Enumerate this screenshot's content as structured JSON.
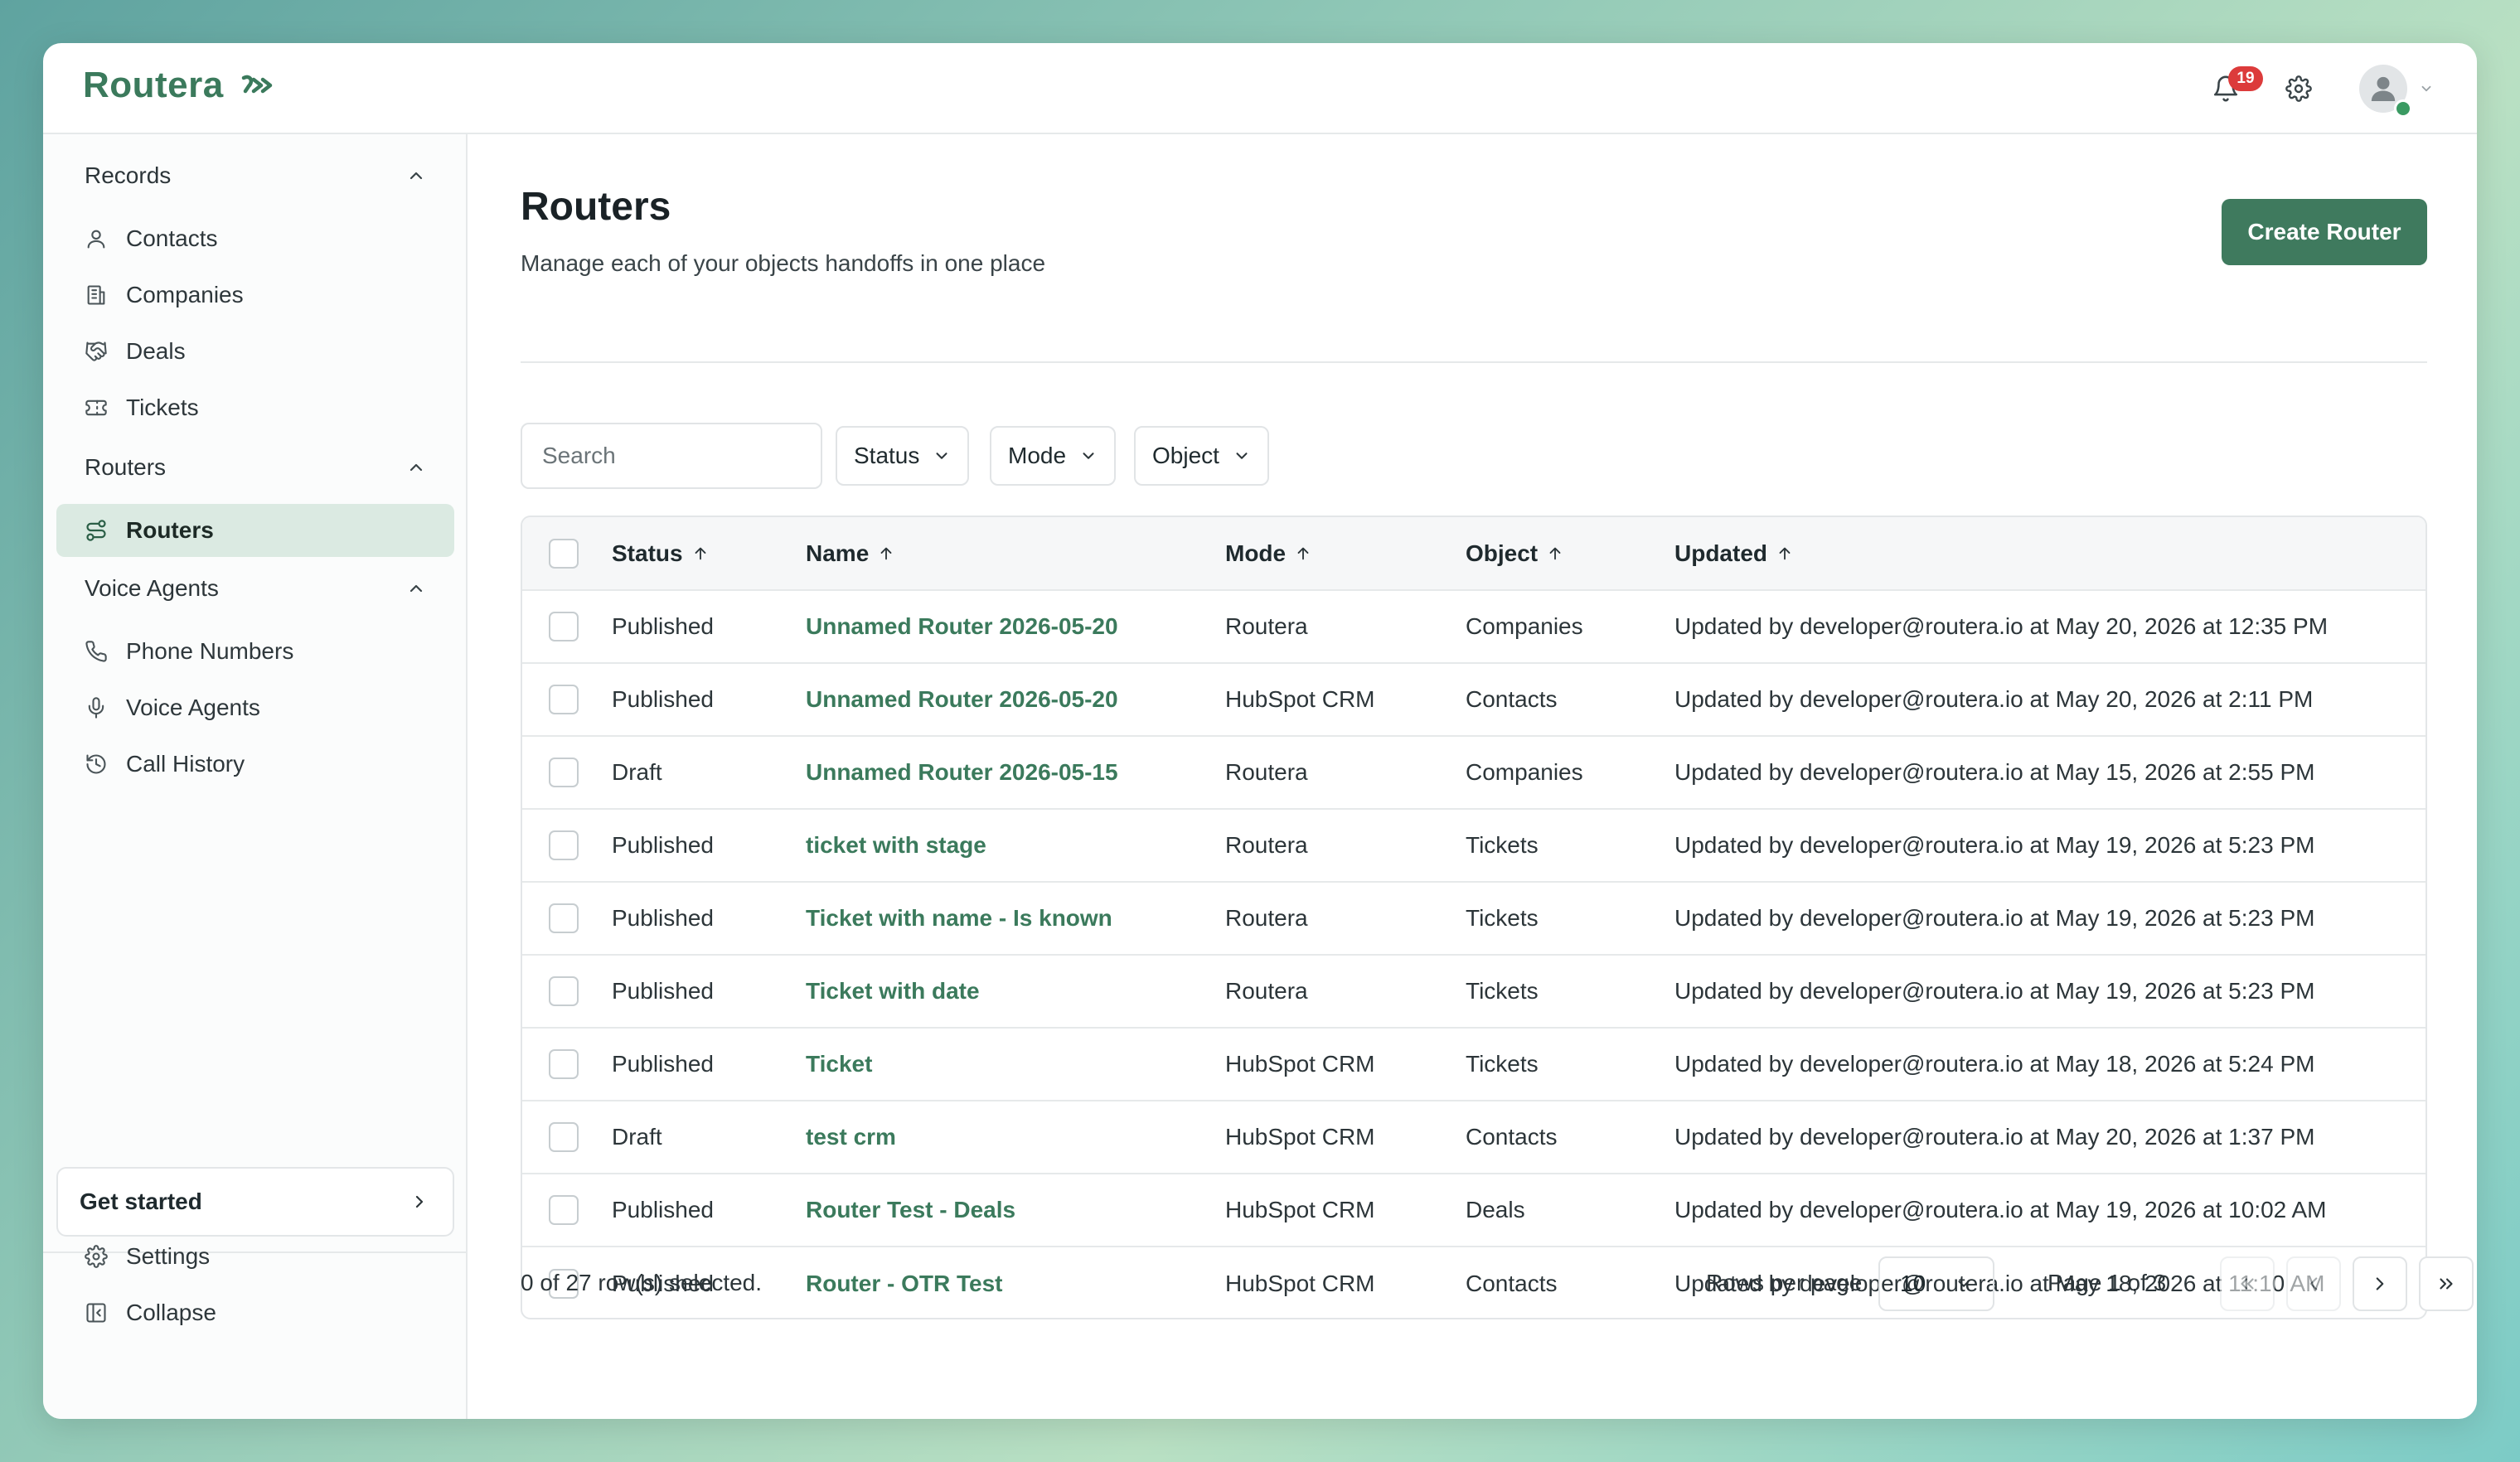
{
  "app": {
    "logo_text": "Routera",
    "notification_count": "19",
    "brand_color": "#3b7a5c",
    "accent_button_color": "#3f7a5e",
    "badge_color": "#dc3b3b"
  },
  "sidebar": {
    "sections": [
      {
        "title": "Records",
        "items": [
          {
            "label": "Contacts",
            "icon": "user-icon"
          },
          {
            "label": "Companies",
            "icon": "building-icon"
          },
          {
            "label": "Deals",
            "icon": "handshake-icon"
          },
          {
            "label": "Tickets",
            "icon": "ticket-icon"
          }
        ]
      },
      {
        "title": "Routers",
        "items": [
          {
            "label": "Routers",
            "icon": "route-icon",
            "active": true
          }
        ]
      },
      {
        "title": "Voice Agents",
        "items": [
          {
            "label": "Phone Numbers",
            "icon": "phone-icon"
          },
          {
            "label": "Voice Agents",
            "icon": "microphone-icon"
          },
          {
            "label": "Call History",
            "icon": "history-icon"
          }
        ]
      }
    ],
    "get_started": "Get started",
    "settings": "Settings",
    "collapse": "Collapse"
  },
  "main": {
    "title": "Routers",
    "subtitle": "Manage each of your objects handoffs in one place",
    "create_button": "Create Router",
    "search_placeholder": "Search",
    "filters": {
      "status": "Status",
      "mode": "Mode",
      "object": "Object"
    }
  },
  "table": {
    "headers": {
      "status": "Status",
      "name": "Name",
      "mode": "Mode",
      "object": "Object",
      "updated": "Updated"
    },
    "rows": [
      {
        "status": "Published",
        "name": "Unnamed Router 2026-05-20",
        "mode": "Routera",
        "object": "Companies",
        "updated": "Updated by developer@routera.io at May 20, 2026 at 12:35 PM"
      },
      {
        "status": "Published",
        "name": "Unnamed Router 2026-05-20",
        "mode": "HubSpot CRM",
        "object": "Contacts",
        "updated": "Updated by developer@routera.io at May 20, 2026 at 2:11 PM"
      },
      {
        "status": "Draft",
        "name": "Unnamed Router 2026-05-15",
        "mode": "Routera",
        "object": "Companies",
        "updated": "Updated by developer@routera.io at May 15, 2026 at 2:55 PM"
      },
      {
        "status": "Published",
        "name": "ticket with stage",
        "mode": "Routera",
        "object": "Tickets",
        "updated": "Updated by developer@routera.io at May 19, 2026 at 5:23 PM"
      },
      {
        "status": "Published",
        "name": "Ticket with name - Is known",
        "mode": "Routera",
        "object": "Tickets",
        "updated": "Updated by developer@routera.io at May 19, 2026 at 5:23 PM"
      },
      {
        "status": "Published",
        "name": "Ticket with date",
        "mode": "Routera",
        "object": "Tickets",
        "updated": "Updated by developer@routera.io at May 19, 2026 at 5:23 PM"
      },
      {
        "status": "Published",
        "name": "Ticket",
        "mode": "HubSpot CRM",
        "object": "Tickets",
        "updated": "Updated by developer@routera.io at May 18, 2026 at 5:24 PM"
      },
      {
        "status": "Draft",
        "name": "test crm",
        "mode": "HubSpot CRM",
        "object": "Contacts",
        "updated": "Updated by developer@routera.io at May 20, 2026 at 1:37 PM"
      },
      {
        "status": "Published",
        "name": "Router Test - Deals",
        "mode": "HubSpot CRM",
        "object": "Deals",
        "updated": "Updated by developer@routera.io at May 19, 2026 at 10:02 AM"
      },
      {
        "status": "Published",
        "name": "Router - OTR Test",
        "mode": "HubSpot CRM",
        "object": "Contacts",
        "updated": "Updated by developer@routera.io at May 18, 2026 at 11:10 AM"
      }
    ]
  },
  "footer": {
    "selected_text": "0 of 27 row(s) selected.",
    "rows_per_page_label": "Rows per page",
    "rows_per_page_value": "10",
    "page_info": "Page 1 of 3"
  }
}
